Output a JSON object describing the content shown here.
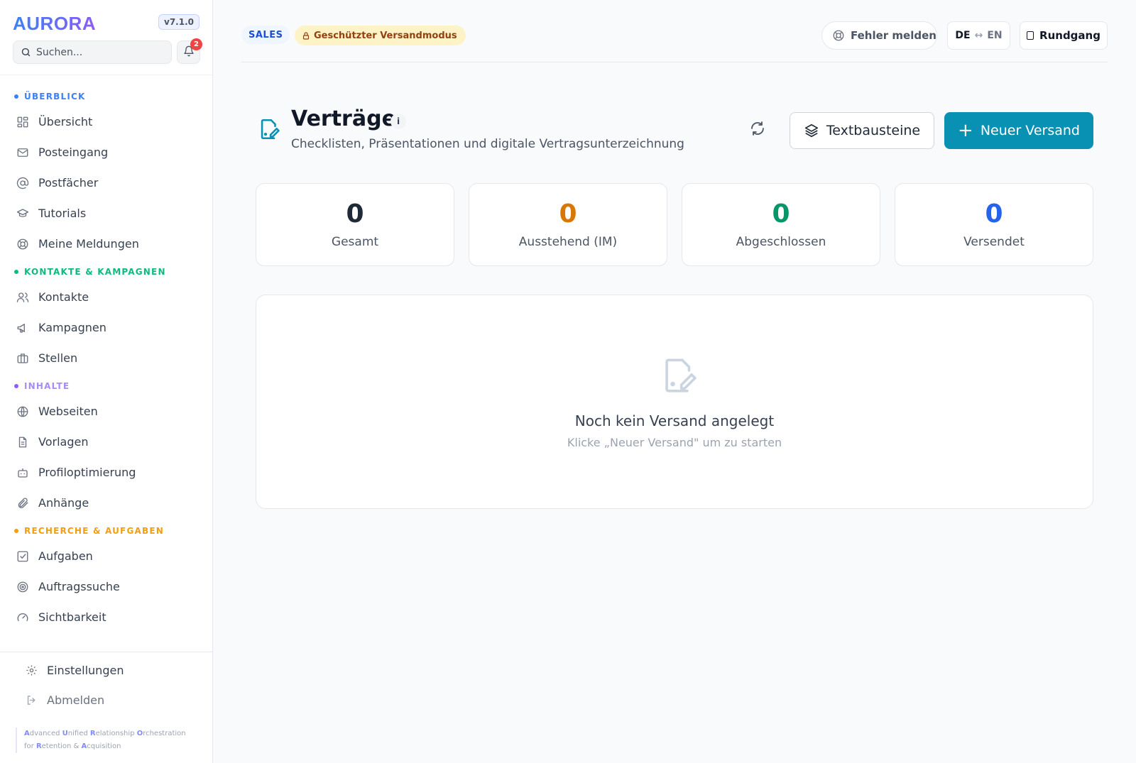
{
  "brand": {
    "name": "AURORA",
    "version": "v7.1.0"
  },
  "search": {
    "placeholder": "Suchen..."
  },
  "notifications": {
    "count": "2"
  },
  "sidebar": {
    "sections": [
      {
        "title": "ÜBERBLICK",
        "color": "#3b82f6",
        "items": [
          {
            "label": "Übersicht",
            "icon": "dashboard-icon"
          },
          {
            "label": "Posteingang",
            "icon": "mail-icon"
          },
          {
            "label": "Postfächer",
            "icon": "at-sign-icon"
          },
          {
            "label": "Tutorials",
            "icon": "graduation-cap-icon"
          },
          {
            "label": "Meine Meldungen",
            "icon": "lifebuoy-icon"
          }
        ]
      },
      {
        "title": "KONTAKTE & KAMPAGNEN",
        "color": "#10b981",
        "items": [
          {
            "label": "Kontakte",
            "icon": "users-icon"
          },
          {
            "label": "Kampagnen",
            "icon": "megaphone-icon"
          },
          {
            "label": "Stellen",
            "icon": "briefcase-icon"
          }
        ]
      },
      {
        "title": "INHALTE",
        "color": "#8b5cf6",
        "items": [
          {
            "label": "Webseiten",
            "icon": "globe-icon"
          },
          {
            "label": "Vorlagen",
            "icon": "file-text-icon"
          },
          {
            "label": "Profiloptimierung",
            "icon": "bot-icon"
          },
          {
            "label": "Anhänge",
            "icon": "paperclip-icon"
          }
        ]
      },
      {
        "title": "RECHERCHE & AUFGABEN",
        "color": "#f59e0b",
        "items": [
          {
            "label": "Aufgaben",
            "icon": "check-square-icon"
          },
          {
            "label": "Auftragssuche",
            "icon": "target-icon"
          },
          {
            "label": "Sichtbarkeit",
            "icon": "gauge-icon"
          }
        ]
      }
    ],
    "bottom": {
      "settings": "Einstellungen",
      "logout": "Abmelden"
    },
    "tagline": "Advanced Unified Relationship Orchestration for Retention & Acquisition"
  },
  "topbar": {
    "tag": "SALES",
    "mode": "Geschützter Versandmodus",
    "report": "Fehler melden",
    "lang_de": "DE",
    "lang_arrow": "↔",
    "lang_en": "EN",
    "tour": "Rundgang"
  },
  "header": {
    "title": "Verträge",
    "info": "i",
    "subtitle": "Checklisten, Präsentationen und digitale Vertragsunterzeichnung",
    "textblocks": "Textbausteine",
    "new": "Neuer Versand",
    "new_plus": "+"
  },
  "stats": [
    {
      "value": "0",
      "label": "Gesamt",
      "color": "#1f2937"
    },
    {
      "value": "0",
      "label": "Ausstehend (IM)",
      "color": "#d97706"
    },
    {
      "value": "0",
      "label": "Abgeschlossen",
      "color": "#059669"
    },
    {
      "value": "0",
      "label": "Versendet",
      "color": "#2563eb"
    }
  ],
  "empty": {
    "title": "Noch kein Versand angelegt",
    "hint": "Klicke „Neuer Versand\" um zu starten"
  }
}
